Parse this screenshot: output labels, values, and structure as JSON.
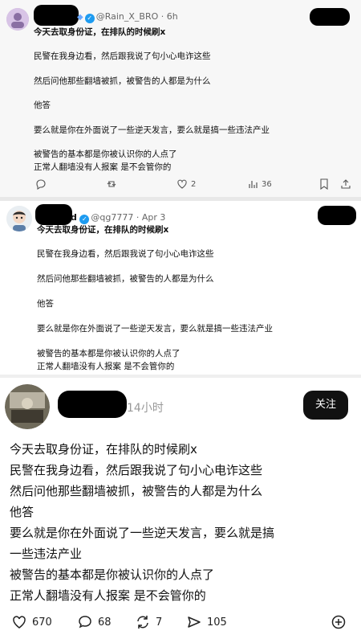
{
  "post1": {
    "handle": "@Rain_X_BRO",
    "time": "6h",
    "lines": [
      "今天去取身份证，在排队的时候刷x",
      "民警在我身边看，然后跟我说了句小心电诈这些",
      "然后问他那些翻墙被抓，被警告的人都是为什么",
      "他答",
      "要么就是你在外面说了一些逆天发言，要么就是搞一些违法产业",
      "被警告的基本都是你被认识你的人点了",
      "正常人翻墙没有人报案 是不会管你的"
    ],
    "actions": {
      "likes": "2",
      "views": "36"
    }
  },
  "post2": {
    "name_suffix": "d",
    "handle": "@qg7777",
    "time": "Apr 3",
    "lines": [
      "今天去取身份证，在排队的时候刷x",
      "民警在我身边看，然后跟我说了句小心电诈这些",
      "然后问他那些翻墙被抓，被警告的人都是为什么",
      "他答",
      "要么就是你在外面说了一些逆天发言，要么就是搞一些违法产业",
      "被警告的基本都是你被认识你的人点了",
      "正常人翻墙没有人报案 是不会管你的"
    ]
  },
  "post3": {
    "time": "14小时",
    "follow_label": "关注",
    "lines": [
      "今天去取身份证，在排队的时候刷x",
      "民警在我身边看，然后跟我说了句小心电诈这些",
      "然后问他那些翻墙被抓，被警告的人都是为什么",
      "他答",
      "要么就是你在外面说了一些逆天发言，要么就是搞",
      "一些违法产业",
      "被警告的基本都是你被认识你的人点了",
      "正常人翻墙没有人报案 是不会管你的"
    ],
    "actions": {
      "likes": "670",
      "comments": "68",
      "reposts": "7",
      "shares": "105"
    }
  },
  "colors": {
    "verified": "#1d9bf0",
    "follow_bg": "#111111",
    "page_bg_post1": "#f7f7f7"
  },
  "icons": [
    "comment-icon",
    "retweet-icon",
    "heart-icon",
    "views-icon",
    "bookmark-icon",
    "share-icon",
    "repost-icon",
    "forward-icon",
    "add-icon",
    "verified-badge-icon"
  ]
}
